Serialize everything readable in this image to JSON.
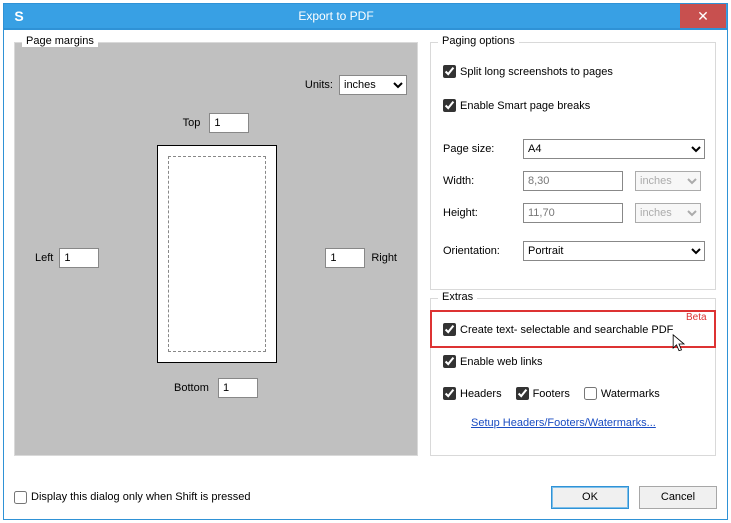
{
  "window": {
    "app_glyph": "S",
    "title": "Export to PDF",
    "close_glyph": "✕"
  },
  "margins": {
    "legend": "Page margins",
    "units_label": "Units:",
    "units_value": "inches",
    "top_label": "Top",
    "top_value": "1",
    "left_label": "Left",
    "left_value": "1",
    "right_label": "Right",
    "right_value": "1",
    "bottom_label": "Bottom",
    "bottom_value": "1"
  },
  "paging": {
    "legend": "Paging options",
    "split_label": "Split long screenshots to pages",
    "split_checked": true,
    "smart_label": "Enable Smart page breaks",
    "smart_checked": true,
    "page_size_label": "Page size:",
    "page_size_value": "A4",
    "width_label": "Width:",
    "width_value": "8,30",
    "width_units": "inches",
    "height_label": "Height:",
    "height_value": "11,70",
    "height_units": "inches",
    "orientation_label": "Orientation:",
    "orientation_value": "Portrait"
  },
  "extras": {
    "legend": "Extras",
    "searchable_label": "Create text- selectable and searchable PDF",
    "searchable_checked": true,
    "beta_badge": "Beta",
    "weblinks_label": "Enable web links",
    "weblinks_checked": true,
    "headers_label": "Headers",
    "headers_checked": true,
    "footers_label": "Footers",
    "footers_checked": true,
    "watermarks_label": "Watermarks",
    "watermarks_checked": false,
    "setup_link": "Setup Headers/Footers/Watermarks..."
  },
  "footer": {
    "display_only_shift_label": "Display this dialog only when Shift is pressed",
    "display_only_shift_checked": false,
    "ok_label": "OK",
    "cancel_label": "Cancel"
  }
}
